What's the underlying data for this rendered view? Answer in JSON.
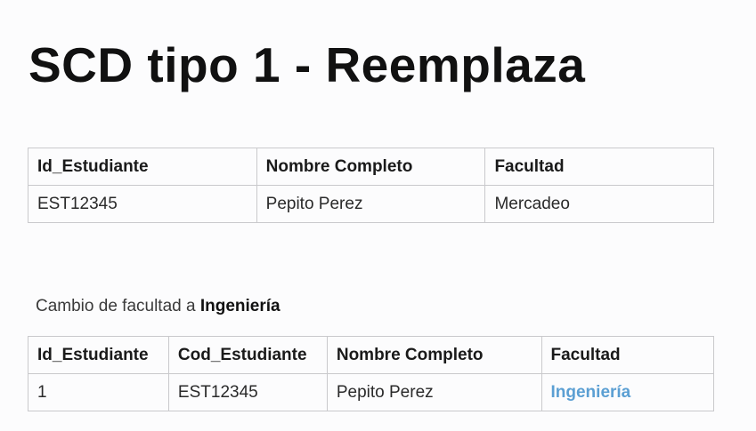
{
  "title": "SCD tipo 1 - Reemplaza",
  "table_before": {
    "headers": [
      "Id_Estudiante",
      "Nombre Completo",
      "Facultad"
    ],
    "rows": [
      [
        "EST12345",
        "Pepito Perez",
        "Mercadeo"
      ]
    ]
  },
  "change_note": {
    "prefix": "Cambio de facultad a",
    "value": "Ingeniería"
  },
  "table_after": {
    "headers": [
      "Id_Estudiante",
      "Cod_Estudiante",
      "Nombre Completo",
      "Facultad"
    ],
    "rows": [
      [
        "1",
        "EST12345",
        "Pepito Perez",
        "Ingeniería"
      ]
    ]
  },
  "colors": {
    "highlight": "#5b9fd3",
    "border": "#c9c9cc",
    "background": "#fcfcfd"
  }
}
